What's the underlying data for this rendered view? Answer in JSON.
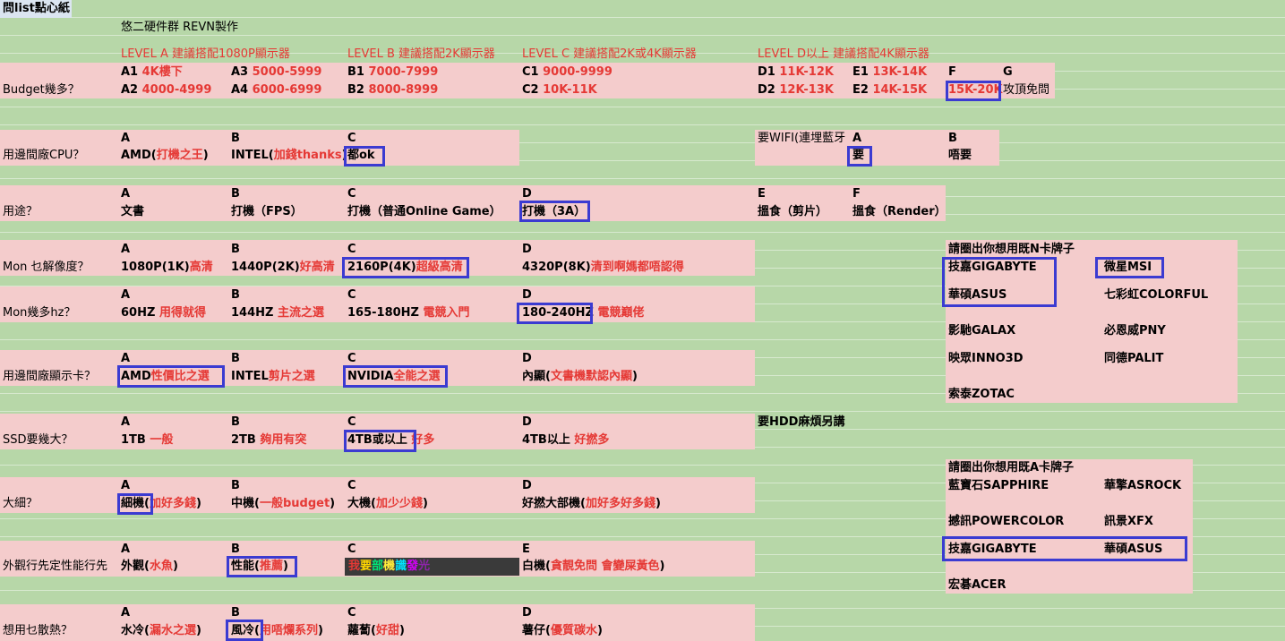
{
  "sheet": {
    "title": "問list點心紙",
    "author": "悠二硬件群 REVN製作"
  },
  "levels": {
    "a": "LEVEL A 建議搭配1080P顯示器",
    "b": "LEVEL B 建議搭配2K顯示器",
    "c": "LEVEL C 建議搭配2K或4K顯示器",
    "d": "LEVEL D以上 建議搭配4K顯示器"
  },
  "budget": {
    "q": "Budget幾多？",
    "a1_code": "A1",
    "a1_val": "4K樓下",
    "a2_code": "A2",
    "a2_val": "4000-4999",
    "a3_code": "A3",
    "a3_val": "5000-5999",
    "a4_code": "A4",
    "a4_val": "6000-6999",
    "b1_code": "B1",
    "b1_val": "7000-7999",
    "b2_code": "B2",
    "b2_val": "8000-8999",
    "c1_code": "C1",
    "c1_val": "9000-9999",
    "c2_code": "C2",
    "c2_val": "10K-11K",
    "d1_code": "D1",
    "d1_val": "11K-12K",
    "d2_code": "D2",
    "d2_val": "12K-13K",
    "e1_code": "E1",
    "e1_val": "13K-14K",
    "e2_code": "E2",
    "e2_val": "14K-15K",
    "f_code": "F",
    "f_val": "15K-20K",
    "g_code": "G",
    "g_val": "攻頂免問"
  },
  "cpu": {
    "q": "用邊間廠CPU？",
    "a": "A",
    "a_main": "AMD(",
    "a_red": "打機之王",
    "a_end": ")",
    "b": "B",
    "b_main": "INTEL(",
    "b_red": "加錢thanks",
    "b_end": ")",
    "c": "C",
    "c_main": "都ok"
  },
  "wifi": {
    "q": "要WIFI(連埋藍牙",
    "a": "A",
    "a_val": "要",
    "b": "B",
    "b_val": "唔要"
  },
  "use": {
    "q": "用途？",
    "a": "A",
    "a_val": "文書",
    "b": "B",
    "b_val": "打機（FPS）",
    "c": "C",
    "c_val": "打機（普通Online Game）",
    "d": "D",
    "d_val": "打機（3A）",
    "e": "E",
    "e_val": "搵食（剪片）",
    "f": "F",
    "f_val": "搵食（Render）"
  },
  "res": {
    "q": "Mon 乜解像度？",
    "a": "A",
    "a_main": "1080P(1K)",
    "a_red": "高清",
    "b": "B",
    "b_main": "1440P(2K)",
    "b_red": "好高清",
    "c": "C",
    "c_main": "2160P(4K)",
    "c_red": "超級高清",
    "d": "D",
    "d_main": "4320P(8K)",
    "d_red": "清到啊媽都唔認得"
  },
  "hz": {
    "q": "Mon幾多hz？",
    "a": "A",
    "a_main": "60HZ",
    "a_red": "用得就得",
    "b": "B",
    "b_main": "144HZ",
    "b_red": "主流之選",
    "c": "C",
    "c_main": "165-180HZ",
    "c_red": "電競入門",
    "d": "D",
    "d_main": "180-240HZ",
    "d_red": "電競巔佬"
  },
  "gpu": {
    "q": "用邊間廠顯示卡？",
    "a": "A",
    "a_main": "AMD",
    "a_red": "性價比之選",
    "b": "B",
    "b_main": "INTEL",
    "b_red": "剪片之選",
    "c": "C",
    "c_main": "NVIDIA",
    "c_red": "全能之選",
    "d": "D",
    "d_main": "內顯(",
    "d_red": "文書機默認內顯",
    "d_end": ")"
  },
  "ssd": {
    "q": "SSD要幾大？",
    "a": "A",
    "a_main": "1TB",
    "a_red": "一般",
    "b": "B",
    "b_main": "2TB",
    "b_red": "夠用有突",
    "c": "C",
    "c_main": "4TB或以上",
    "c_red": "好多",
    "d": "D",
    "d_main": "4TB以上",
    "d_red": "好撚多"
  },
  "hdd": {
    "q": "要HDD麻煩另講"
  },
  "size": {
    "q": "大細？",
    "a": "A",
    "a_main": "細機(",
    "a_red": "加好多錢",
    "a_end": ")",
    "b": "B",
    "b_main": "中機(",
    "b_red": "一般budget",
    "b_end": ")",
    "c": "C",
    "c_main": "大機(",
    "c_red": "加少少錢",
    "c_end": ")",
    "d": "D",
    "d_main": "好撚大部機(",
    "d_red": "加好多好多錢",
    "d_end": ")"
  },
  "look": {
    "q": "外觀行先定性能行先",
    "a": "A",
    "a_main": "外觀(",
    "a_red": "水魚",
    "a_end": ")",
    "b": "B",
    "b_main": "性能(",
    "b_red": "推薦",
    "b_end": ")",
    "c": "C",
    "c_rgb": [
      "我",
      "要",
      "部",
      "機",
      "識",
      "發",
      "光"
    ],
    "e": "E",
    "e_main": "白機(",
    "e_red": "貪靚免問 會變屎黃色",
    "e_end": ")"
  },
  "cool": {
    "q": "想用乜散熱？",
    "a": "A",
    "a_main": "水冷(",
    "a_red": "漏水之選",
    "a_end": ")",
    "b": "B",
    "b_main": "風冷(",
    "b_red": "用唔爛系列",
    "b_end": ")",
    "c": "C",
    "c_main": "蘿蔔(",
    "c_red": "好甜",
    "c_end": ")",
    "d": "D",
    "d_main": "薯仔(",
    "d_red": "優質碳水",
    "d_end": ")"
  },
  "nbrand": {
    "q": "請圈出你想用既N卡牌子",
    "items": [
      "技嘉GIGABYTE",
      "微星MSI",
      "華碩ASUS",
      "七彩虹COLORFUL",
      "影馳GALAX",
      "必恩威PNY",
      "映眾INNO3D",
      "同德PALIT",
      "索泰ZOTAC"
    ]
  },
  "abrand": {
    "q": "請圈出你想用既A卡牌子",
    "items": [
      "藍寶石SAPPHIRE",
      "華擎ASROCK",
      "撼訊POWERCOLOR",
      "訊景XFX",
      "技嘉GIGABYTE",
      "華碩ASUS",
      "宏碁ACER"
    ]
  },
  "colors": {
    "grid": "#b7d7a8",
    "pink": "#f4cccc",
    "red": "#e53935",
    "circle": "#3b3bd1"
  }
}
